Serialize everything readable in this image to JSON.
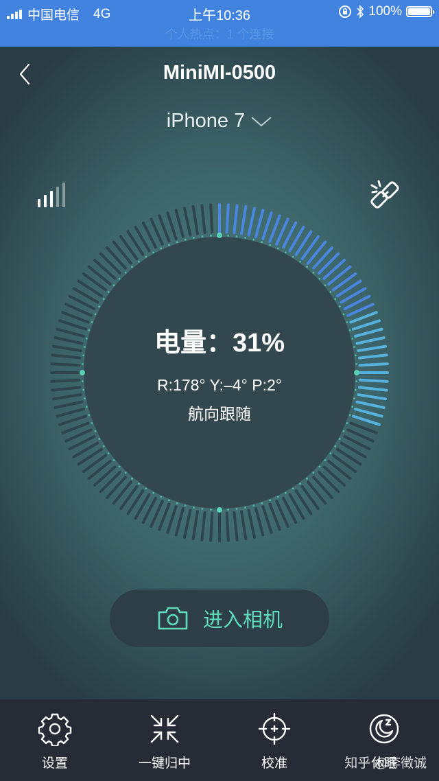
{
  "status_bar": {
    "carrier": "中国电信",
    "network": "4G",
    "time": "上午10:36",
    "battery": "100%",
    "battery_level": 1.0,
    "hotspot": "个人热点：1 个连接"
  },
  "header": {
    "title": "MiniMI-0500",
    "device": "iPhone 7"
  },
  "gimbal": {
    "signal_strength_bars": 3,
    "signal_total_bars": 5,
    "battery_label": "电量：",
    "battery_value": "31%",
    "battery_fraction": 0.31,
    "angles": "R:178° Y:–4° P:2°",
    "mode": "航向跟随"
  },
  "colors": {
    "accent": "#5fdcbc",
    "battery_ticks": "#4a86e0",
    "battery_ticks_end": "#56b2dd",
    "ticks_off": "#2f454d",
    "statusbar": "#4183de"
  },
  "camera_button": {
    "label": "进入相机",
    "icon": "camera-icon"
  },
  "tabbar": {
    "items": [
      {
        "label": "设置",
        "icon": "gear-icon"
      },
      {
        "label": "一键归中",
        "icon": "recenter-icon"
      },
      {
        "label": "校准",
        "icon": "crosshair-icon"
      },
      {
        "label": "休眠",
        "icon": "sleep-moon-icon"
      }
    ]
  },
  "watermark": "知乎 @李徵诚"
}
